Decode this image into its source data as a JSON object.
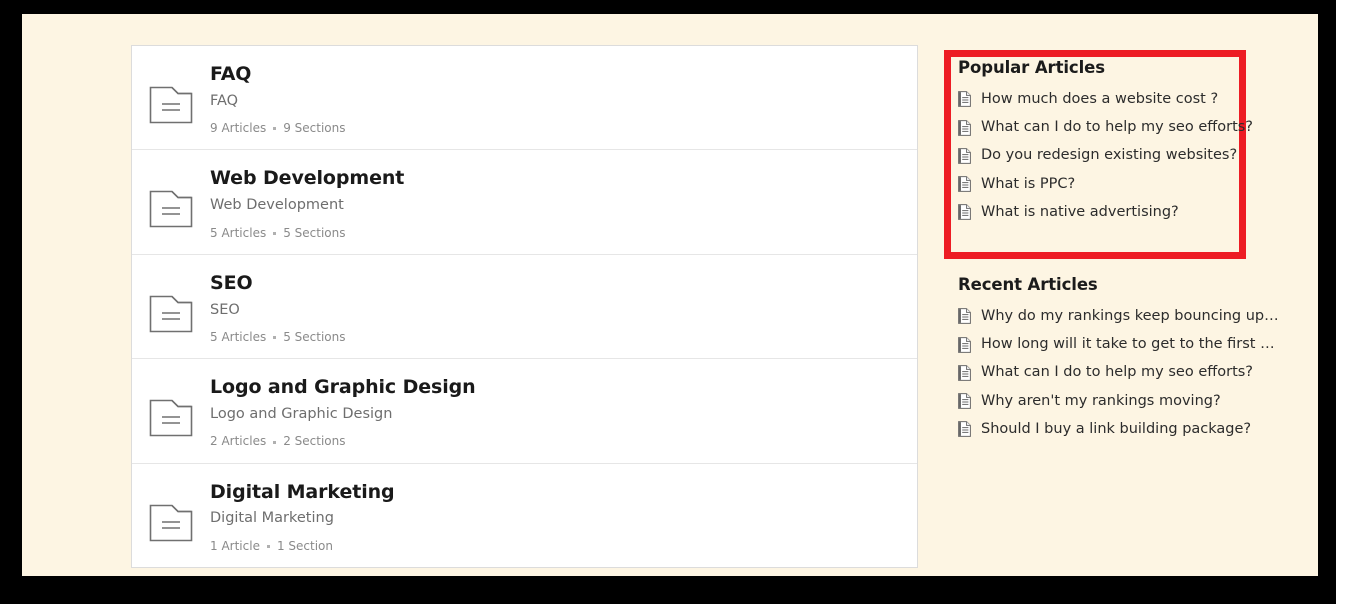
{
  "theme": {
    "page_background": "#fdf5e3",
    "card_background": "#ffffff",
    "frame_color": "#000000",
    "highlight_box_color": "#ed1c24",
    "title_color": "#1a1a1a",
    "muted_text_color": "#6e6e6e",
    "meta_text_color": "#8a8a8a"
  },
  "categories": [
    {
      "title": "FAQ",
      "description": "FAQ",
      "articles": "9 Articles",
      "sections": "9 Sections",
      "icon": "folder-icon"
    },
    {
      "title": "Web Development",
      "description": "Web Development",
      "articles": "5 Articles",
      "sections": "5 Sections",
      "icon": "folder-icon"
    },
    {
      "title": "SEO",
      "description": "SEO",
      "articles": "5 Articles",
      "sections": "5 Sections",
      "icon": "folder-icon"
    },
    {
      "title": "Logo and Graphic Design",
      "description": "Logo and Graphic Design",
      "articles": "2 Articles",
      "sections": "2 Sections",
      "icon": "folder-icon"
    },
    {
      "title": "Digital Marketing",
      "description": "Digital Marketing",
      "articles": "1 Article",
      "sections": "1 Section",
      "icon": "folder-icon"
    }
  ],
  "popular": {
    "heading": "Popular Articles",
    "items": [
      {
        "label": "How much does a website cost ?",
        "icon": "document-icon"
      },
      {
        "label": "What can I do to help my seo efforts?",
        "icon": "document-icon"
      },
      {
        "label": "Do you redesign existing websites?",
        "icon": "document-icon"
      },
      {
        "label": "What is PPC?",
        "icon": "document-icon"
      },
      {
        "label": "What is native advertising?",
        "icon": "document-icon"
      }
    ]
  },
  "recent": {
    "heading": "Recent Articles",
    "items": [
      {
        "label": "Why do my rankings keep bouncing up…",
        "icon": "document-icon"
      },
      {
        "label": "How long will it take to get to the first …",
        "icon": "document-icon"
      },
      {
        "label": "What can I do to help my seo efforts?",
        "icon": "document-icon"
      },
      {
        "label": "Why aren't my rankings moving?",
        "icon": "document-icon"
      },
      {
        "label": "Should I buy a link building package?",
        "icon": "document-icon"
      }
    ]
  }
}
